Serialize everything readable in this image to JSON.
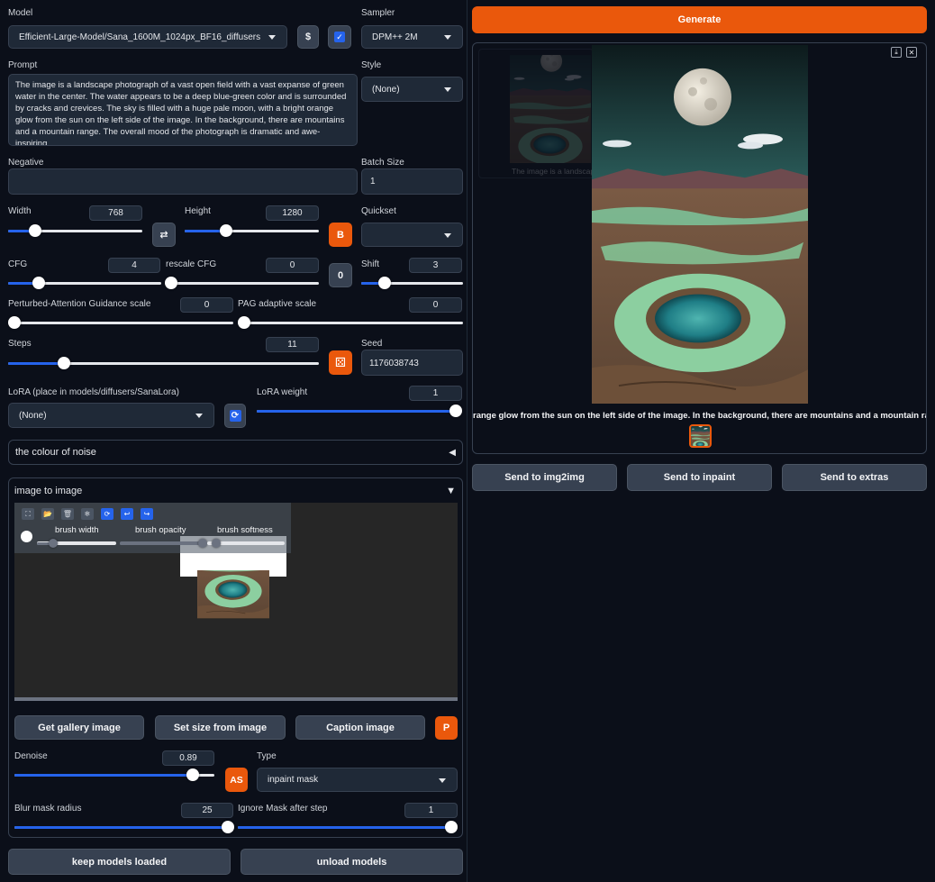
{
  "model": {
    "label": "Model",
    "value": "Efficient-Large-Model/Sana_1600M_1024px_BF16_diffusers"
  },
  "sampler": {
    "label": "Sampler",
    "value": "DPM++ 2M"
  },
  "prompt": {
    "label": "Prompt",
    "value": "The image is a landscape photograph of a vast open field with a vast expanse of green water in the center. The water appears to be a deep blue-green color and is surrounded by cracks and crevices. The sky is filled with a huge pale moon, with a bright orange glow from the sun on the left side of the image. In the background, there are mountains and a mountain range. The overall mood of the photograph is dramatic and awe-inspiring."
  },
  "style": {
    "label": "Style",
    "value": "(None)"
  },
  "negative": {
    "label": "Negative",
    "value": ""
  },
  "batch_size": {
    "label": "Batch Size",
    "value": "1"
  },
  "width": {
    "label": "Width",
    "value": "768",
    "level": 0.2
  },
  "height": {
    "label": "Height",
    "value": "1280",
    "level": 0.31
  },
  "quickset": {
    "label": "Quickset",
    "value": ""
  },
  "cfg": {
    "label": "CFG",
    "value": "4",
    "level": 0.2
  },
  "rescale_cfg": {
    "label": "rescale CFG",
    "value": "0",
    "level": 0.0
  },
  "zero_button": "0",
  "shift": {
    "label": "Shift",
    "value": "3",
    "level": 0.23
  },
  "pag_scale": {
    "label": "Perturbed-Attention Guidance scale",
    "value": "0",
    "level": 0.0
  },
  "pag_adaptive": {
    "label": "PAG adaptive scale",
    "value": "0",
    "level": 0.0
  },
  "steps": {
    "label": "Steps",
    "value": "11",
    "level": 0.18
  },
  "seed": {
    "label": "Seed",
    "value": "1176038743"
  },
  "lora": {
    "label": "LoRA (place in models/diffusers/SanaLora)",
    "value": "(None)"
  },
  "lora_weight": {
    "label": "LoRA weight",
    "value": "1",
    "level": 1.0
  },
  "swap_icon": "⇄",
  "b_button": "B",
  "dice_icon": "⚄",
  "refresh_icon": "⟳",
  "dollar_icon": "$",
  "check_icon": "✓",
  "noise_accordion": {
    "label": "the colour of noise",
    "icon": "◀"
  },
  "img2img_accordion": {
    "label": "image to image",
    "icon": "▼"
  },
  "brush": {
    "width_label": "brush width",
    "opacity_label": "brush opacity",
    "softness_label": "brush softness",
    "width_level": 0.2,
    "opacity_level": 1.0,
    "softness_level": 0.0
  },
  "toolbar_icons": [
    "⛶",
    "📂",
    "🗑",
    "❄",
    "⟳",
    "↩",
    "↪"
  ],
  "get_gallery_image": "Get gallery image",
  "set_size_from_image": "Set size from image",
  "caption_image": "Caption image",
  "p_button": "P",
  "denoise": {
    "label": "Denoise",
    "value": "0.89",
    "level": 0.89
  },
  "as_button": "AS",
  "type": {
    "label": "Type",
    "value": "inpaint mask"
  },
  "blur_mask": {
    "label": "Blur mask radius",
    "value": "25",
    "level": 1.0
  },
  "ignore_mask": {
    "label": "Ignore Mask after step",
    "value": "1",
    "level": 1.0
  },
  "keep_models_loaded": "keep models loaded",
  "unload_models": "unload models",
  "generate": "Generate",
  "gallery": {
    "caption": "range glow from the sun on the left side of the image. In the background, there are mountains and a mountain range. The",
    "thumb_caption": "The image is a landscape",
    "download_icon": "⤓",
    "close_icon": "✕"
  },
  "send_img2img": "Send to img2img",
  "send_inpaint": "Send to inpaint",
  "send_extras": "Send to extras",
  "colors": {
    "accent": "#ea580c",
    "slider": "#2563eb",
    "bg": "#0b0f19",
    "surface": "#1f2937"
  }
}
